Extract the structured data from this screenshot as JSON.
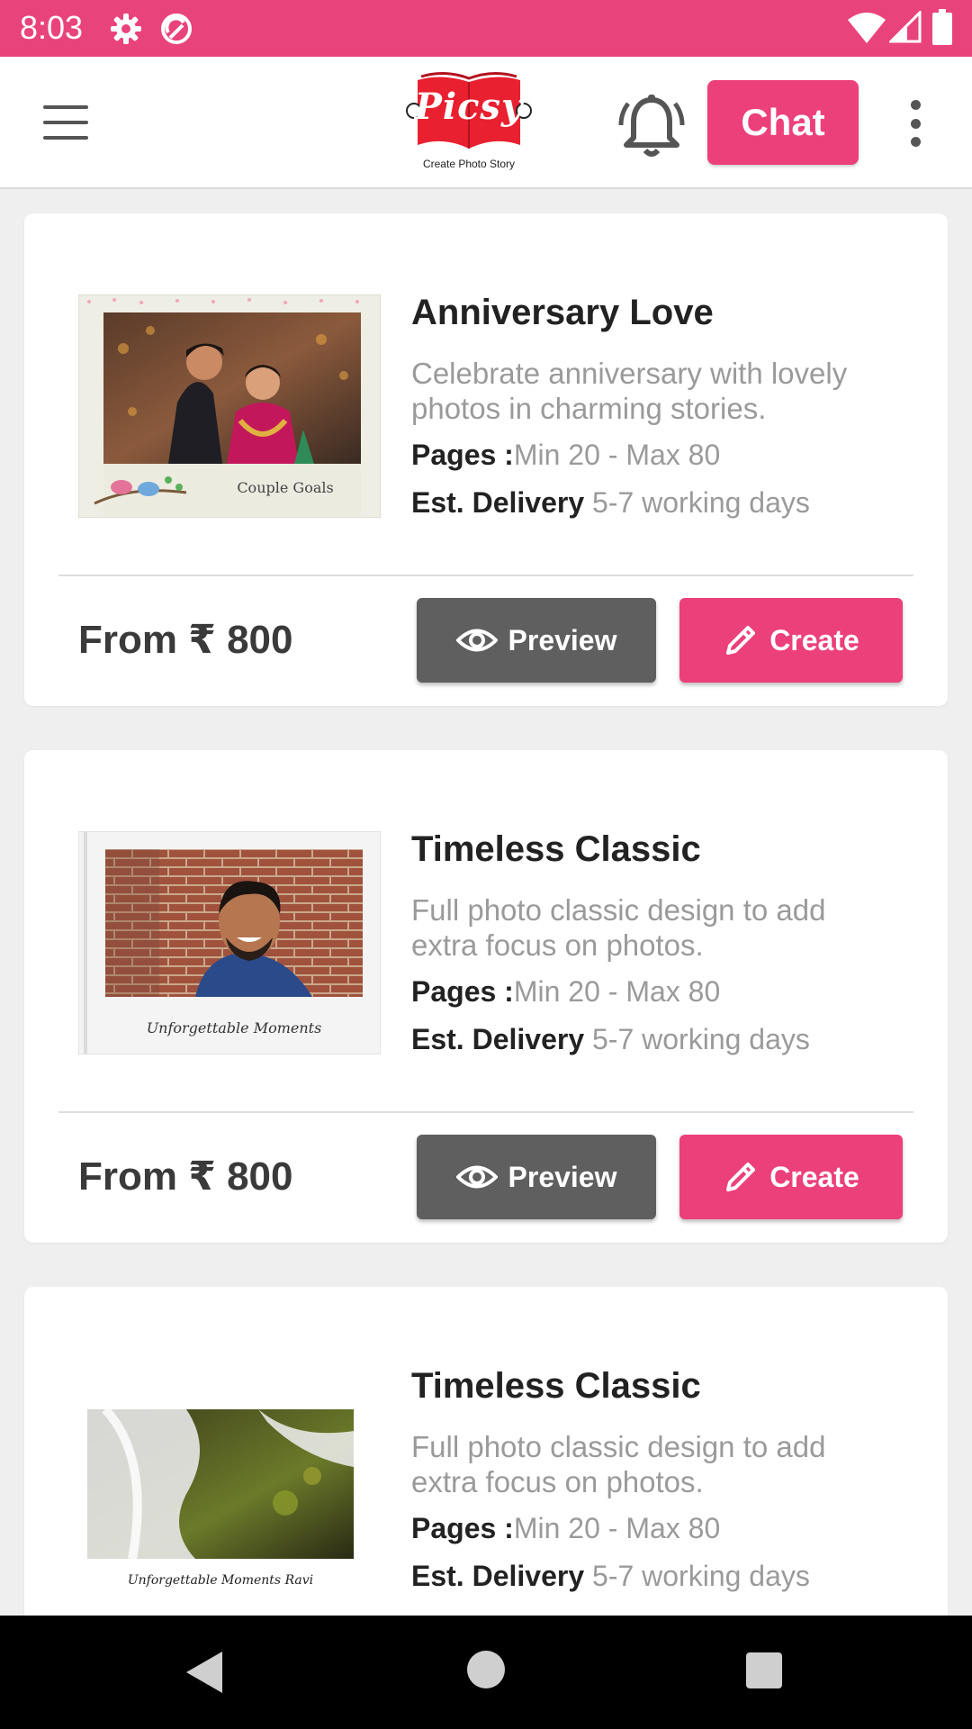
{
  "status_bar": {
    "time": "8:03",
    "icons": [
      "gear-icon",
      "sync-icon",
      "wifi-icon",
      "signal-icon",
      "battery-icon"
    ]
  },
  "app_bar": {
    "menu_icon": "hamburger-menu-icon",
    "logo_text": "Picsy",
    "logo_tagline": "Create Photo Story",
    "bell_icon": "bell-icon",
    "chat_label": "Chat",
    "more_icon": "more-vertical-icon"
  },
  "colors": {
    "accent": "#ec407a",
    "status_bar": "#e9437b",
    "preview_button": "#5f5f5f",
    "logo_red": "#e8202f"
  },
  "products": [
    {
      "title": "Anniversary Love",
      "description": "Celebrate anniversary with lovely photos in charming stories.",
      "pages_label": "Pages :",
      "pages_value": "Min 20 - Max 80",
      "delivery_label": "Est. Delivery",
      "delivery_value": " 5-7 working days",
      "thumb_caption": "Couple Goals",
      "price": "From ₹ 800",
      "preview_label": "Preview",
      "create_label": "Create"
    },
    {
      "title": "Timeless Classic",
      "description": "Full photo classic design to add extra focus on photos.",
      "pages_label": "Pages :",
      "pages_value": "Min 20 - Max 80",
      "delivery_label": "Est. Delivery",
      "delivery_value": " 5-7 working days",
      "thumb_caption": "Unforgettable Moments",
      "price": "From ₹ 800",
      "preview_label": "Preview",
      "create_label": "Create"
    },
    {
      "title": "Timeless Classic",
      "description": "Full photo classic design to add extra focus on photos.",
      "pages_label": "Pages :",
      "pages_value": "Min 20 - Max 80",
      "delivery_label": "Est. Delivery",
      "delivery_value": " 5-7 working days",
      "thumb_caption": "Unforgettable Moments Ravi"
    }
  ],
  "nav_bar": {
    "icons": [
      "back-icon",
      "home-icon",
      "recents-icon"
    ]
  }
}
